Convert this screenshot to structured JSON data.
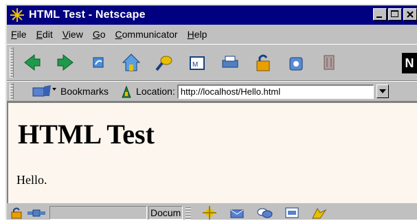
{
  "window": {
    "title": "HTML Test - Netscape",
    "title_bar_color": "#000080"
  },
  "menu": [
    {
      "label": "File",
      "underline": "F"
    },
    {
      "label": "Edit",
      "underline": "E"
    },
    {
      "label": "View",
      "underline": "V"
    },
    {
      "label": "Go",
      "underline": "G"
    },
    {
      "label": "Communicator",
      "underline": "C"
    },
    {
      "label": "Help",
      "underline": "H"
    }
  ],
  "toolbar": {
    "buttons": [
      "back-icon",
      "forward-icon",
      "reload-icon",
      "home-icon",
      "search-icon",
      "my-netscape-icon",
      "print-icon",
      "security-icon",
      "shop-icon",
      "stop-icon"
    ],
    "logo": "N"
  },
  "location_bar": {
    "bookmarks_label": "Bookmarks",
    "location_label": "Location:",
    "url": "http://localhost/Hello.html"
  },
  "page": {
    "heading": "HTML Test",
    "body_text": "Hello.",
    "background": "#fdf6ee"
  },
  "status_bar": {
    "status_text": "Docum"
  }
}
